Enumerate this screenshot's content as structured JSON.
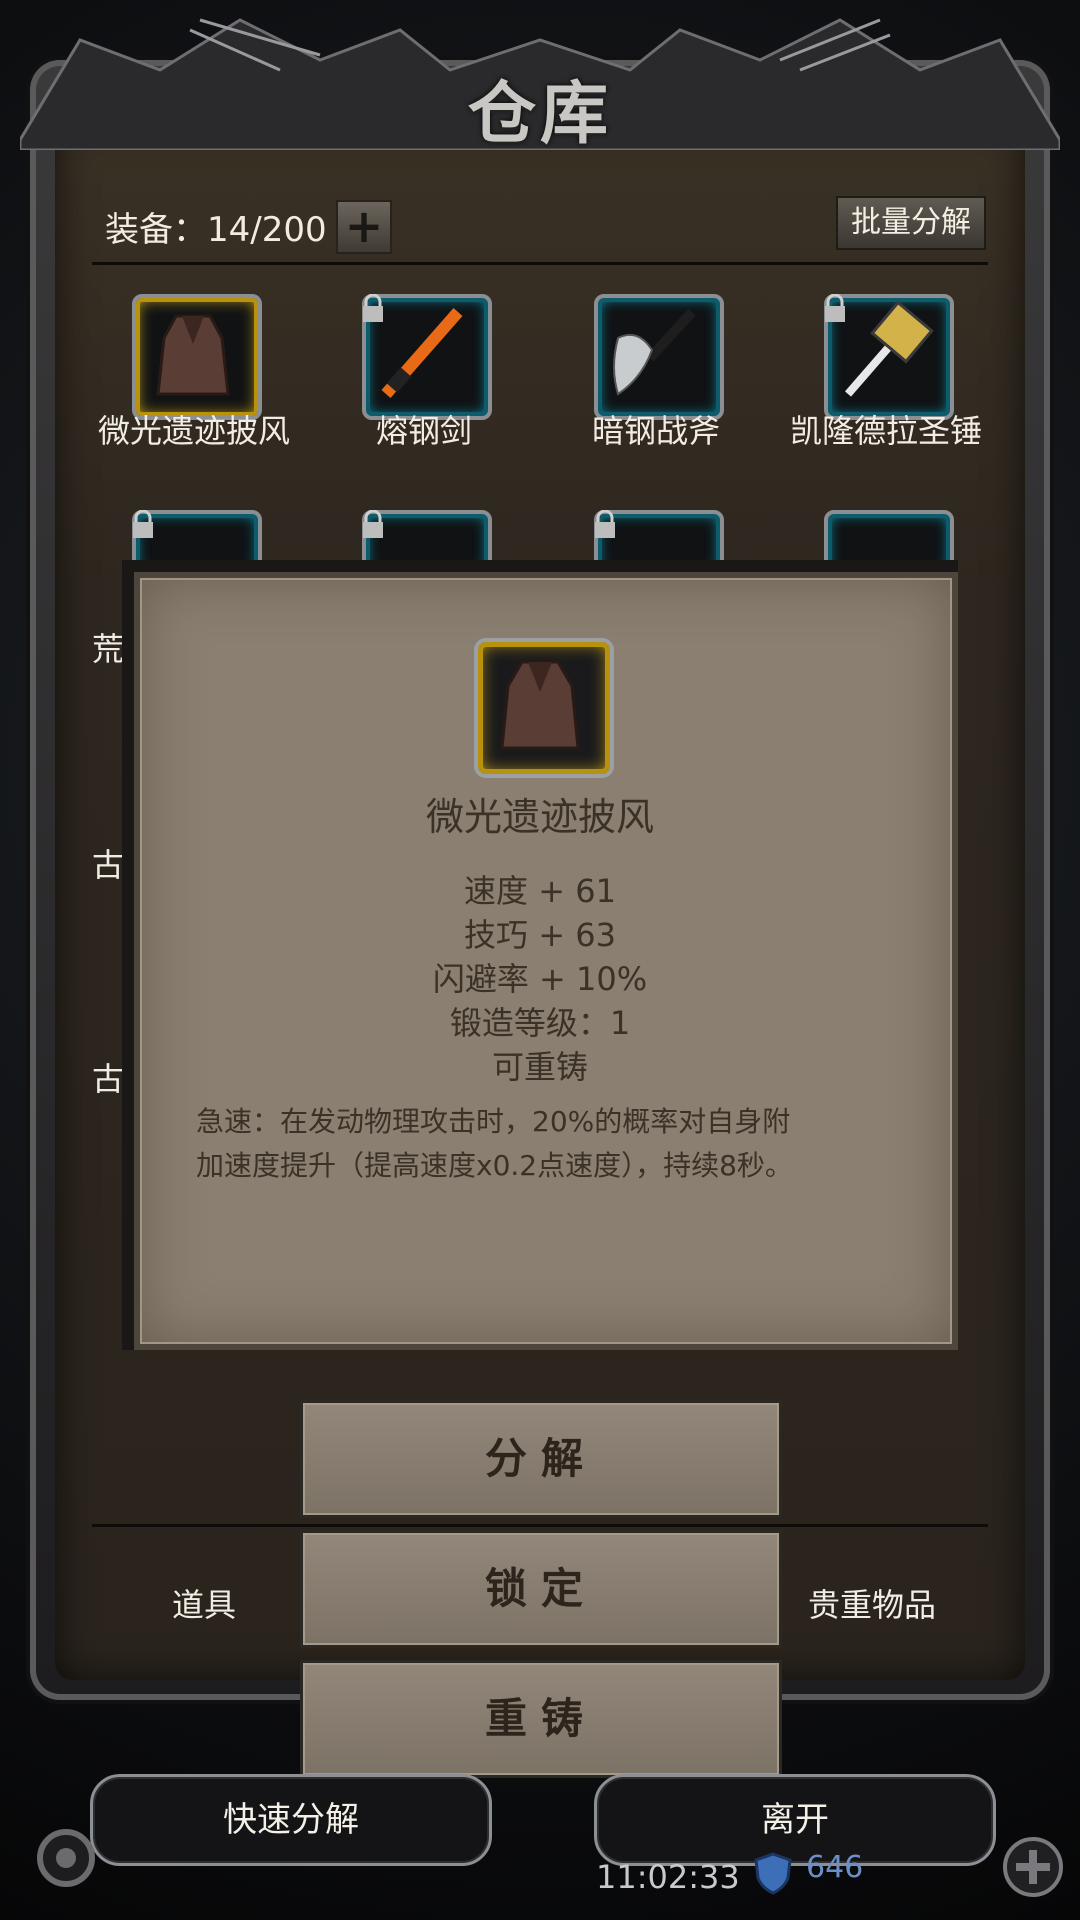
{
  "window": {
    "title": "仓库"
  },
  "inventory": {
    "capacity_text": "装备：14/200",
    "add_label": "+",
    "batch_decompose_label": "批量分解"
  },
  "items": [
    {
      "label": "微光遗迹披风",
      "rarity": "gold",
      "locked": false,
      "icon": "cloak-icon"
    },
    {
      "label": "熔钢剑",
      "rarity": "blue",
      "locked": true,
      "icon": "sword-icon"
    },
    {
      "label": "暗钢战斧",
      "rarity": "blue",
      "locked": false,
      "icon": "axe-icon"
    },
    {
      "label": "凯隆德拉圣锤",
      "rarity": "blue",
      "locked": true,
      "icon": "hammer-icon"
    }
  ],
  "row2_partial_labels": {
    "left": "荒",
    "right": ""
  },
  "row3_partial_labels": {
    "left": "古",
    "right": ""
  },
  "row4_partial_labels": {
    "left": "古"
  },
  "tooltip": {
    "name": "微光遗迹披风",
    "stats": [
      "速度 + 61",
      "技巧 + 63",
      "闪避率 + 10%",
      "锻造等级：1",
      "可重铸"
    ],
    "description_line1": "急速：在发动物理攻击时，20%的概率对自身附",
    "description_line2": "加速度提升（提高速度x0.2点速度），持续8秒。"
  },
  "actions": {
    "decompose": "分解",
    "lock": "锁定",
    "reforge": "重铸"
  },
  "tabs": {
    "left": "道具",
    "right": "贵重物品"
  },
  "bottom_bar": {
    "quick_decompose": "快速分解",
    "leave": "离开",
    "time": "11:02:33",
    "gem_count": "646"
  },
  "colors": {
    "popup_bg": "#8a7f70",
    "gold_rarity": "#e0b51a",
    "blue_rarity": "#0aa6c0"
  }
}
